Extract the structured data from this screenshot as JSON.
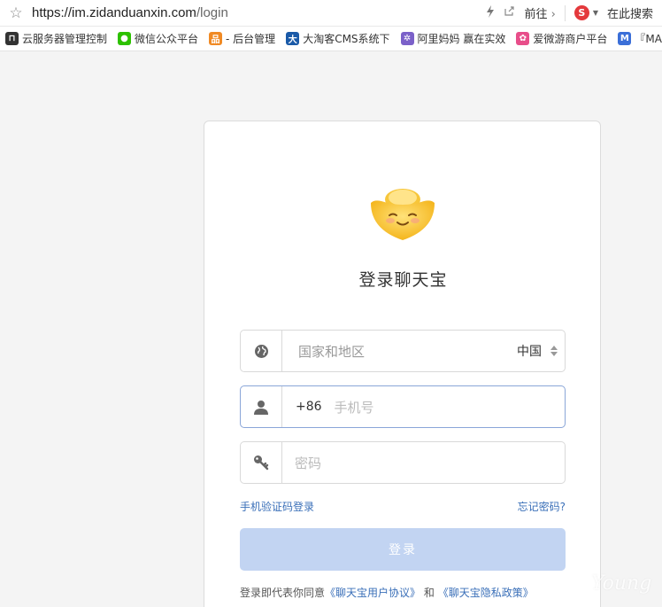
{
  "browser": {
    "url_host": "https://im.zidanduanxin.com",
    "url_path": "/login",
    "forward_label": "前往",
    "search_label": "在此搜索",
    "search_engine_letter": "S"
  },
  "bookmarks": [
    {
      "label": "云服务器管理控制",
      "icon": "server-icon",
      "color": "#333333",
      "glyph": "⊓"
    },
    {
      "label": "微信公众平台",
      "icon": "wechat-icon",
      "color": "#2dc100",
      "glyph": "●"
    },
    {
      "label": "- 后台管理",
      "icon": "admin-icon",
      "color": "#f08a24",
      "glyph": "品"
    },
    {
      "label": "大淘客CMS系统下",
      "icon": "dataoke-icon",
      "color": "#1a5aa8",
      "glyph": "大"
    },
    {
      "label": "阿里妈妈 赢在实效",
      "icon": "alimama-icon",
      "color": "#7b61c9",
      "glyph": "✲"
    },
    {
      "label": "爱微游商户平台",
      "icon": "aiweiyou-icon",
      "color": "#e84e8a",
      "glyph": "✿"
    },
    {
      "label": "『MA",
      "icon": "m-icon",
      "color": "#3b6fd8",
      "glyph": "M"
    }
  ],
  "login": {
    "title": "登录聊天宝",
    "country_placeholder": "国家和地区",
    "country_value": "中国",
    "phone_prefix": "+86",
    "phone_placeholder": "手机号",
    "password_placeholder": "密码",
    "sms_login_link": "手机验证码登录",
    "forgot_link": "忘记密码?",
    "login_button": "登录",
    "agreement_prefix": "登录即代表你同意",
    "agreement_user": "《聊天宝用户协议》",
    "agreement_and": "和",
    "agreement_privacy": "《聊天宝隐私政策》"
  },
  "watermark": "Young"
}
